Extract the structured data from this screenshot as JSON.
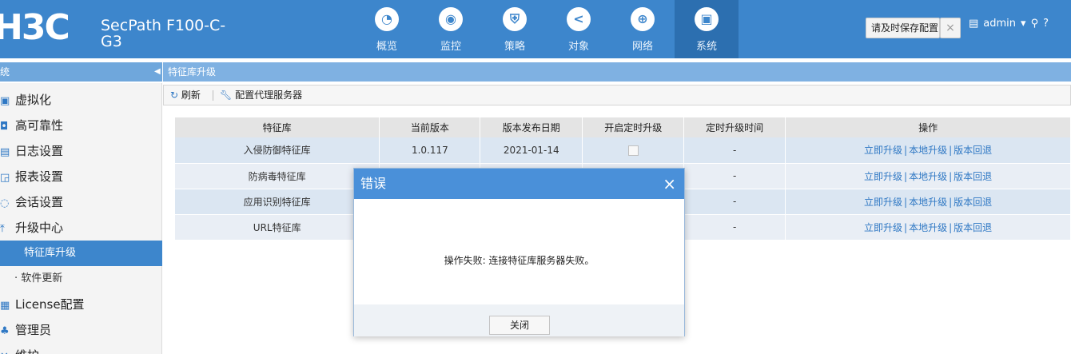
{
  "header": {
    "logo": "H3C",
    "product": "SecPath F100-C-G3",
    "nav": [
      {
        "label": "概览",
        "icon": "dashboard-icon",
        "glyph": "◔"
      },
      {
        "label": "监控",
        "icon": "monitor-icon",
        "glyph": "◉"
      },
      {
        "label": "策略",
        "icon": "shield-icon",
        "glyph": "⛨"
      },
      {
        "label": "对象",
        "icon": "share-icon",
        "glyph": "<"
      },
      {
        "label": "网络",
        "icon": "globe-icon",
        "glyph": "⊕"
      },
      {
        "label": "系统",
        "icon": "system-icon",
        "glyph": "▣"
      }
    ],
    "save_label": "请及时保存配置",
    "save_close": "×",
    "user": "admin",
    "icons": {
      "save": "floppy-icon",
      "user_menu": "caret-down-icon",
      "search": "search-icon",
      "help": "help-icon"
    }
  },
  "sidebar": {
    "title": "统",
    "collapse": "◀",
    "items": [
      {
        "label": "虚拟化",
        "icon": "virtualization-icon",
        "glyph": "▣"
      },
      {
        "label": "高可靠性",
        "icon": "ha-icon",
        "glyph": "◘"
      },
      {
        "label": "日志设置",
        "icon": "log-icon",
        "glyph": "▤"
      },
      {
        "label": "报表设置",
        "icon": "report-icon",
        "glyph": "◲"
      },
      {
        "label": "会话设置",
        "icon": "session-icon",
        "glyph": "◌"
      },
      {
        "label": "升级中心",
        "icon": "upgrade-icon",
        "glyph": "⤒"
      }
    ],
    "sub_items": [
      {
        "label": "特征库升级",
        "active": true
      },
      {
        "label": "· 软件更新",
        "active": false
      }
    ],
    "items2": [
      {
        "label": "License配置",
        "icon": "license-icon",
        "glyph": "▦"
      },
      {
        "label": "管理员",
        "icon": "admin-icon",
        "glyph": "♣"
      },
      {
        "label": "维护",
        "icon": "maintenance-icon",
        "glyph": "✕"
      }
    ]
  },
  "main": {
    "title": "特征库升级",
    "toolbar": {
      "refresh": "刷新",
      "proxy": "配置代理服务器"
    },
    "columns": [
      "特征库",
      "当前版本",
      "版本发布日期",
      "开启定时升级",
      "定时升级时间",
      "操作"
    ],
    "rows": [
      {
        "name": "入侵防御特征库",
        "version": "1.0.117",
        "date": "2021-01-14",
        "time": "-"
      },
      {
        "name": "防病毒特征库",
        "version": "",
        "date": "",
        "time": "-"
      },
      {
        "name": "应用识别特征库",
        "version": "",
        "date": "",
        "time": "-"
      },
      {
        "name": "URL特征库",
        "version": "",
        "date": "",
        "time": "-"
      }
    ],
    "ops": {
      "now": "立即升级",
      "local": "本地升级",
      "rollback": "版本回退",
      "sep": "|"
    }
  },
  "dialog": {
    "title": "错误",
    "close": "×",
    "message": "操作失败: 连接特征库服务器失败。",
    "button": "关闭"
  }
}
